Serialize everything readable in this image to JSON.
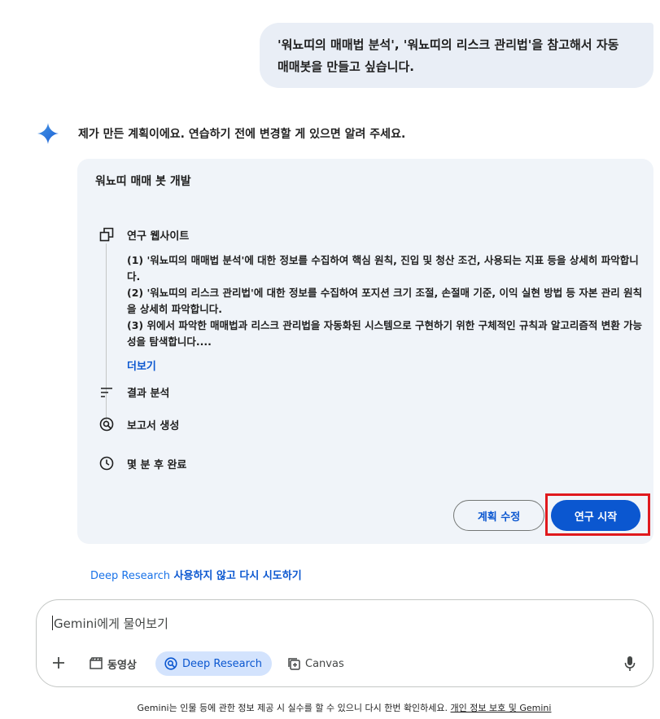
{
  "user_message": {
    "line1": "'워뇨띠의 매매법 분석', '워뇨띠의 리스크 관리법'을 참고해서 자동",
    "line2": "매매봇을 만들고 싶습니다."
  },
  "assistant": {
    "intro": "제가 만든 계획이에요. 연습하기 전에 변경할 게 있으면 알려 주세요."
  },
  "plan_card": {
    "title": "워뇨띠 매매 봇 개발",
    "steps": [
      {
        "label": "연구 웹사이트",
        "icon": "web-windows-icon"
      },
      {
        "label": "결과 분석",
        "icon": "analysis-lines-icon"
      },
      {
        "label": "보고서 생성",
        "icon": "report-search-icon"
      },
      {
        "label": "몇 분 후 완료",
        "icon": "clock-icon"
      }
    ],
    "details": [
      "(1) '워뇨띠의 매매법 분석'에 대한 정보를 수집하여 핵심 원칙, 진입 및 청산 조건, 사용되는 지표 등을 상세히 파악합니다.",
      "(2) '워뇨띠의 리스크 관리법'에 대한 정보를 수집하여 포지션 크기 조절, 손절매 기준, 이익 실현 방법 등 자본 관리 원칙을 상세히 파악합니다.",
      "(3) 위에서 파악한 매매법과 리스크 관리법을 자동화된 시스템으로 구현하기 위한 구체적인 규칙과 알고리즘적 변환 가능성을 탐색합니다...."
    ],
    "more_link": "더보기",
    "edit_button": "계획 수정",
    "start_button": "연구 시작"
  },
  "retry": {
    "prefix": "Deep Research",
    "suffix": " 사용하지 않고 다시 시도하기"
  },
  "input": {
    "placeholder": "Gemini에게 물어보기",
    "tools": {
      "video": "동영상",
      "deep_research": "Deep Research",
      "canvas": "Canvas"
    }
  },
  "footer": {
    "text": "Gemini는 인물 등에 관한 정보 제공 시 실수를 할 수 있으니 다시 한번 확인하세요. ",
    "link": "개인 정보 보호 및 Gemini"
  },
  "colors": {
    "accent": "#0b57d0",
    "card_bg": "#f0f4f9",
    "bubble_bg": "#e9eef6",
    "highlight": "#e0191d"
  }
}
